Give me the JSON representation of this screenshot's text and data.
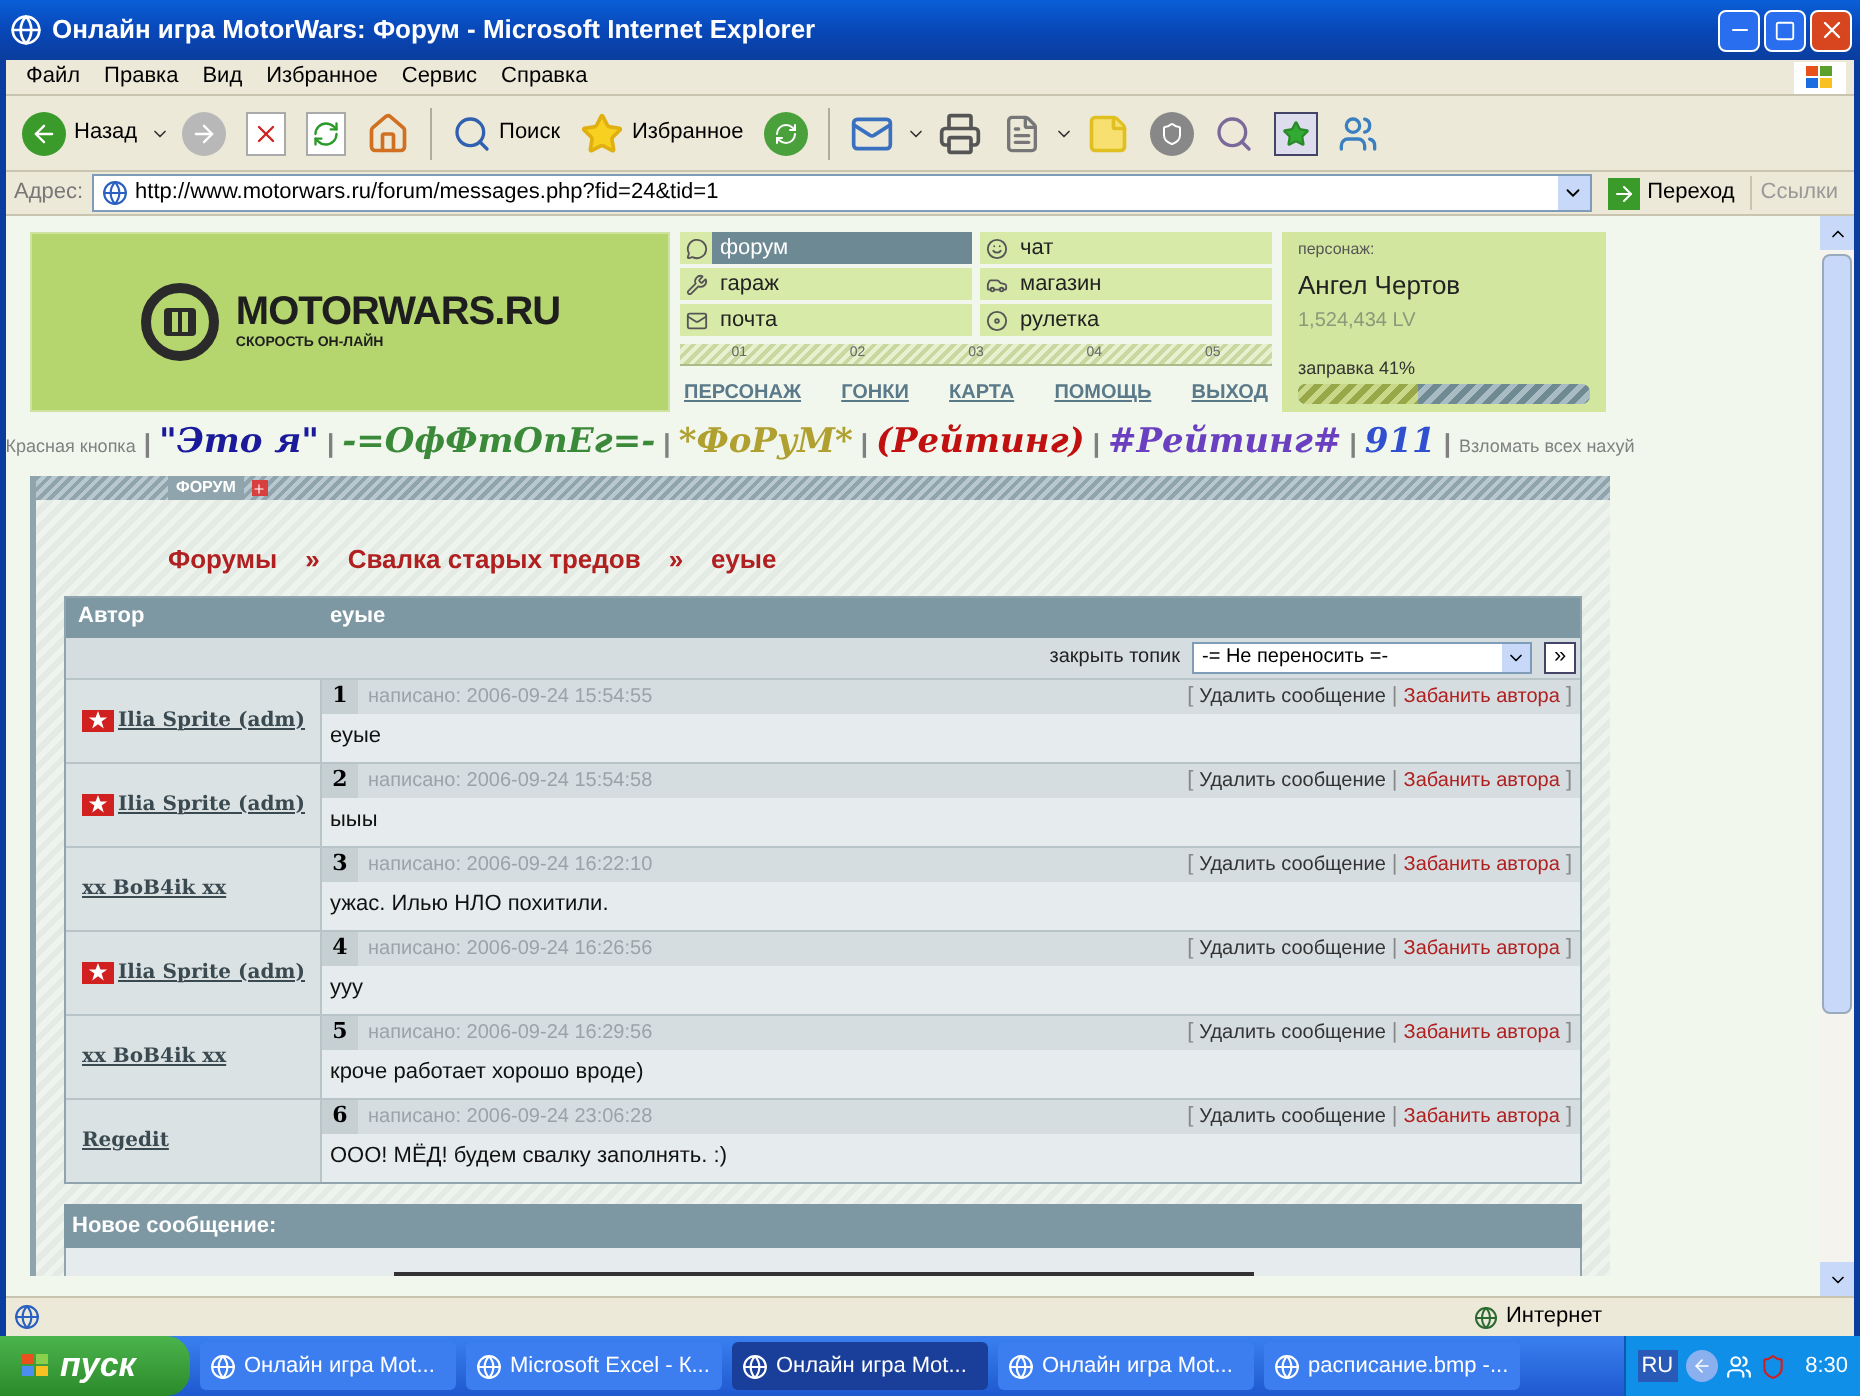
{
  "window": {
    "title": "Онлайн игра MotorWars: Форум - Microsoft Internet Explorer"
  },
  "menu": [
    "Файл",
    "Правка",
    "Вид",
    "Избранное",
    "Сервис",
    "Справка"
  ],
  "toolbar": {
    "back": "Назад",
    "search": "Поиск",
    "favorites": "Избранное"
  },
  "address": {
    "label": "Адрес:",
    "url": "http://www.motorwars.ru/forum/messages.php?fid=24&tid=1",
    "go": "Переход",
    "links": "Ссылки"
  },
  "site": {
    "logo": "MOTORWARS.RU",
    "tagline": "СКОРОСТЬ ОН-ЛАЙН",
    "nav": [
      {
        "label": "форум",
        "selected": true
      },
      {
        "label": "чат",
        "selected": false
      },
      {
        "label": "гараж",
        "selected": false
      },
      {
        "label": "магазин",
        "selected": false
      },
      {
        "label": "почта",
        "selected": false
      },
      {
        "label": "рулетка",
        "selected": false
      }
    ],
    "markers": [
      "01",
      "02",
      "03",
      "04",
      "05"
    ],
    "bottom_links": [
      "ПЕРСОНАЖ",
      "ГОНКИ",
      "КАРТА",
      "ПОМОЩЬ",
      "ВЫХОД"
    ],
    "character": {
      "label": "персонаж:",
      "name": "Ангел Чертов",
      "lv": "1,524,434 LV",
      "fuel": "заправка 41%",
      "level": 0.41
    }
  },
  "links": [
    {
      "text": "Красная кнопка",
      "color": "#808080"
    },
    {
      "text": "|",
      "color": "#808080"
    },
    {
      "text": "\"Это я\"",
      "color": "#1a1a9a"
    },
    {
      "text": "|",
      "color": "#808080"
    },
    {
      "text": "-=ОфФтОnЕг=-",
      "color": "#3a8a3a"
    },
    {
      "text": "|",
      "color": "#808080"
    },
    {
      "text": "*ФоРуМ*",
      "color": "#b0a030"
    },
    {
      "text": "|",
      "color": "#808080"
    },
    {
      "text": "(Рейтинг)",
      "color": "#c01010"
    },
    {
      "text": "|",
      "color": "#808080"
    },
    {
      "text": "#Рейтинг#",
      "color": "#6a40c0"
    },
    {
      "text": "|",
      "color": "#808080"
    },
    {
      "text": "911",
      "color": "#3050d0"
    },
    {
      "text": "|",
      "color": "#808080"
    },
    {
      "text": "Взломать всех нахуй",
      "color": "#808080"
    }
  ],
  "forum": {
    "section": "ФОРУМ",
    "breadcrumb": [
      "Форумы",
      "»",
      "Свалка старых тредов",
      "»",
      "еуые"
    ],
    "columns": [
      "Автор",
      "еуые"
    ],
    "close_label": "закрыть топик",
    "move_select": "-= Не переносить =-",
    "move_go": "»",
    "posts": [
      {
        "author": "Ilia Sprite (adm)",
        "admin": true,
        "number": "1",
        "date": "написано: 2006-09-24 15:54:55",
        "brackets": [
          "[",
          "|",
          "]"
        ],
        "delete": "Удалить сообщение",
        "ban": "Забанить автора",
        "text": "еуые"
      },
      {
        "author": "Ilia Sprite (adm)",
        "admin": true,
        "number": "2",
        "date": "написано: 2006-09-24 15:54:58",
        "brackets": [
          "[",
          "|",
          "]"
        ],
        "delete": "Удалить сообщение",
        "ban": "Забанить автора",
        "text": "ыыы"
      },
      {
        "author": "xx BoB4ik xx",
        "admin": false,
        "number": "3",
        "date": "написано: 2006-09-24 16:22:10",
        "brackets": [
          "[",
          "|",
          "]"
        ],
        "delete": "Удалить сообщение",
        "ban": "Забанить автора",
        "text": "ужас. Илью НЛО похитили."
      },
      {
        "author": "Ilia Sprite (adm)",
        "admin": true,
        "number": "4",
        "date": "написано: 2006-09-24 16:26:56",
        "brackets": [
          "[",
          "|",
          "]"
        ],
        "delete": "Удалить сообщение",
        "ban": "Забанить автора",
        "text": "ууу"
      },
      {
        "author": "xx BoB4ik xx",
        "admin": false,
        "number": "5",
        "date": "написано: 2006-09-24 16:29:56",
        "brackets": [
          "[",
          "|",
          "]"
        ],
        "delete": "Удалить сообщение",
        "ban": "Забанить автора",
        "text": "кроче работает хорошо вроде)"
      },
      {
        "author": "Regedit",
        "admin": false,
        "number": "6",
        "date": "написано: 2006-09-24 23:06:28",
        "brackets": [
          "[",
          "|",
          "]"
        ],
        "delete": "Удалить сообщение",
        "ban": "Забанить автора",
        "text": "ООО! МЁД! будем свалку заполнять. :)"
      }
    ],
    "new_message": "Новое сообщение:"
  },
  "status_bar": {
    "zone": "Интернет"
  },
  "taskbar": {
    "start": "пуск",
    "tasks": [
      {
        "label": "Онлайн игра Mot...",
        "selected": false
      },
      {
        "label": "Microsoft Excel - К...",
        "selected": false
      },
      {
        "label": "Онлайн игра Mot...",
        "selected": true
      },
      {
        "label": "Онлайн игра Mot...",
        "selected": false
      },
      {
        "label": "расписание.bmp -...",
        "selected": false
      }
    ],
    "lang": "RU",
    "clock": "8:30"
  }
}
